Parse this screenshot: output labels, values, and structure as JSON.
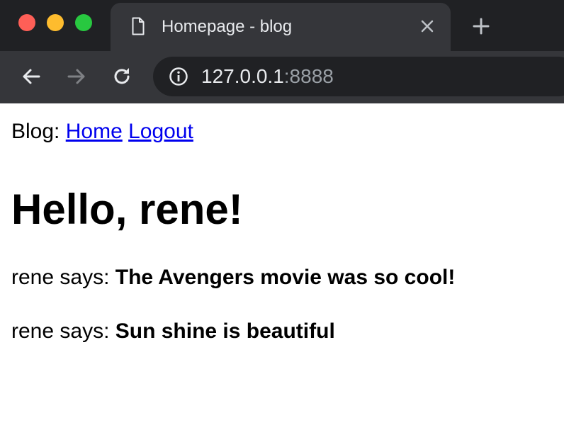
{
  "browser": {
    "tab": {
      "title": "Homepage - blog",
      "icon": "page-icon",
      "close_icon": "close-icon"
    },
    "new_tab_icon": "plus-icon",
    "toolbar": {
      "back_icon": "arrow-left-icon",
      "forward_icon": "arrow-right-icon",
      "reload_icon": "reload-icon",
      "info_icon": "info-icon"
    },
    "address": {
      "host": "127.0.0.1",
      "port": ":8888"
    },
    "colors": {
      "tabstrip": "#202124",
      "tab": "#35363a",
      "close_light": "#fe5f57",
      "minimize_light": "#febc2e",
      "maximize_light": "#28c840",
      "link": "#0000ee"
    }
  },
  "page": {
    "nav": {
      "label": "Blog:",
      "links": [
        "Home",
        "Logout"
      ]
    },
    "heading": "Hello, rene!",
    "posts": [
      {
        "author_prefix": "rene says:",
        "text": "The Avengers movie was so cool!"
      },
      {
        "author_prefix": "rene says:",
        "text": "Sun shine is beautiful"
      }
    ]
  }
}
